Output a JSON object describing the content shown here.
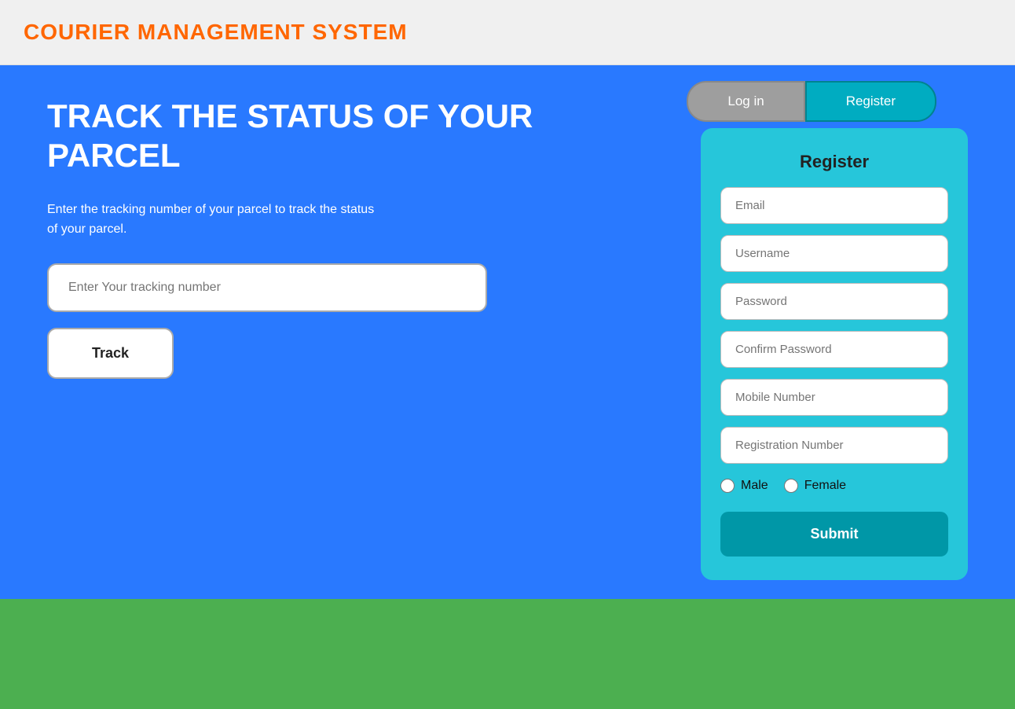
{
  "header": {
    "title": "COURIER MANAGEMENT SYSTEM"
  },
  "tabs": {
    "login_label": "Log in",
    "register_label": "Register"
  },
  "hero": {
    "title": "TRACK THE STATUS OF YOUR PARCEL",
    "description": "Enter the tracking number of your parcel to track the status of your parcel.",
    "tracking_placeholder": "Enter Your tracking number",
    "track_button": "Track"
  },
  "register": {
    "title": "Register",
    "email_placeholder": "Email",
    "username_placeholder": "Username",
    "password_placeholder": "Password",
    "confirm_password_placeholder": "Confirm Password",
    "mobile_placeholder": "Mobile Number",
    "registration_number_placeholder": "Registration Number",
    "gender_male": "Male",
    "gender_female": "Female",
    "submit_label": "Submit"
  }
}
